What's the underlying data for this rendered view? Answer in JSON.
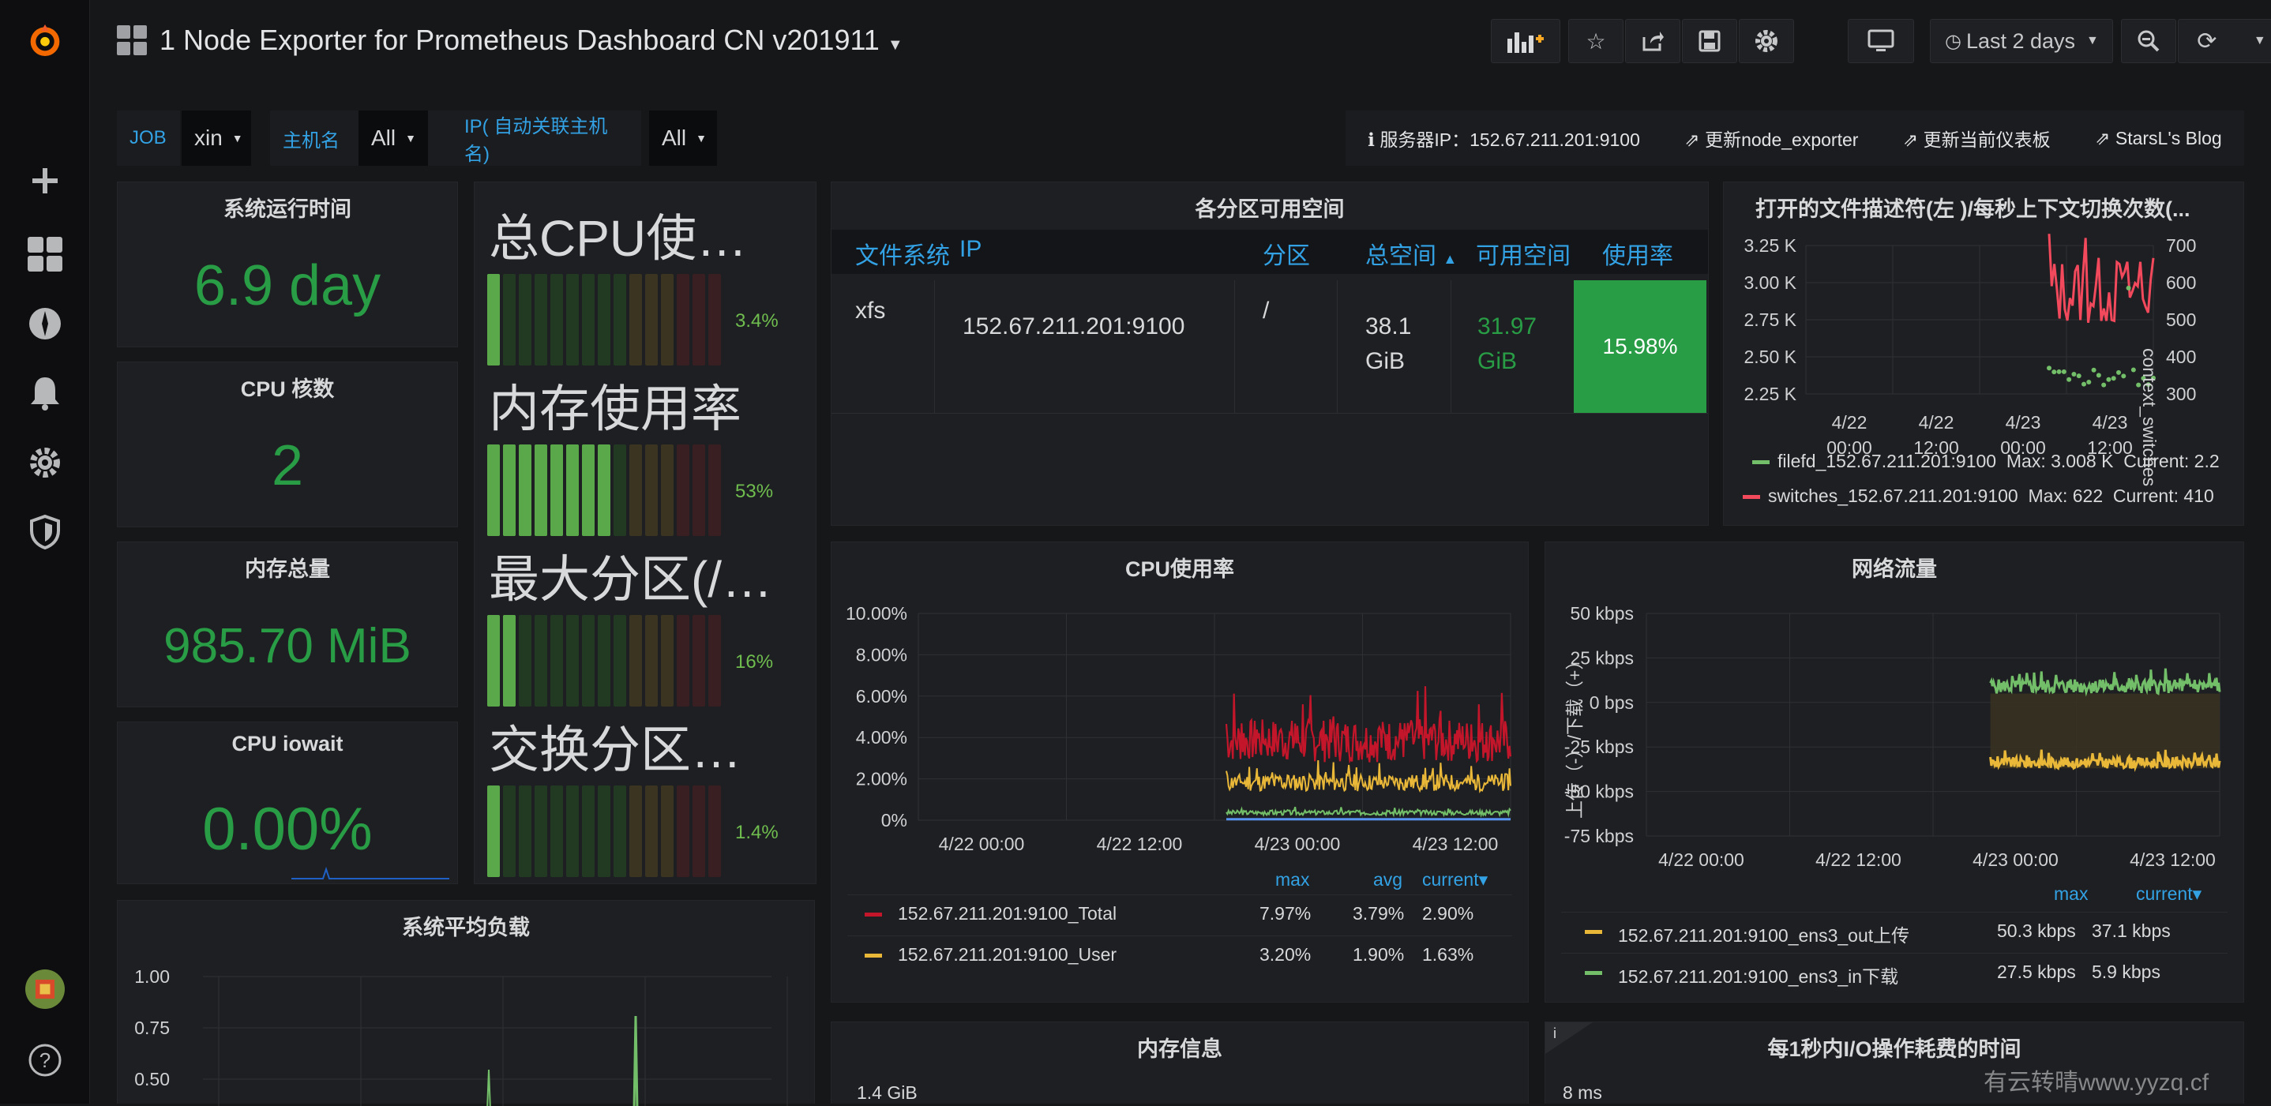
{
  "header": {
    "title": "1 Node Exporter for Prometheus Dashboard CN v201911",
    "time_range": "Last 2 days"
  },
  "variables": [
    {
      "label": "JOB",
      "value": "xin"
    },
    {
      "label": "主机名",
      "value": "All"
    },
    {
      "label": "IP( 自动关联主机名)",
      "value": "All"
    }
  ],
  "links": {
    "server": "服务器IP：152.67.211.201:9100",
    "update_exporter": "更新node_exporter",
    "update_dashboard": "更新当前仪表板",
    "blog": "StarsL's Blog"
  },
  "stats": {
    "uptime": {
      "title": "系统运行时间",
      "value": "6.9 day"
    },
    "cpu_cores": {
      "title": "CPU 核数",
      "value": "2"
    },
    "mem_total": {
      "title": "内存总量",
      "value": "985.70 MiB"
    },
    "iowait": {
      "title": "CPU iowait",
      "value": "0.00%"
    }
  },
  "gauges": [
    {
      "title": "总CPU使用率",
      "value_label": "3.4%",
      "value": 3.4
    },
    {
      "title": "内存使用率",
      "value_label": "53%",
      "value": 53
    },
    {
      "title": "最大分区(/)使用率",
      "value_label": "16%",
      "value": 16
    },
    {
      "title": "交换分区使用率",
      "value_label": "1.4%",
      "value": 1.4
    }
  ],
  "partition_table": {
    "title": "各分区可用空间",
    "headers": [
      "文件系统",
      "IP",
      "分区",
      "总空间",
      "可用空间",
      "使用率"
    ],
    "sort_arrow": "▲",
    "row": {
      "fs": "xfs",
      "ip": "152.67.211.201:9100",
      "mount": "/",
      "total_1": "38.1",
      "total_2": "GiB",
      "avail_1": "31.97",
      "avail_2": "GiB",
      "usage": "15.98%"
    }
  },
  "fd_panel": {
    "title": "打开的文件描述符(左 )/每秒上下文切换次数(...",
    "right_axis_label": "context_switches",
    "legend": [
      {
        "name": "filefd_152.67.211.201:9100",
        "max": "Max: 3.008 K",
        "current": "Current: 2.2",
        "color": "#73bf69"
      },
      {
        "name": "switches_152.67.211.201:9100",
        "max": "Max: 622",
        "current": "Current: 410",
        "color": "#f2495c"
      }
    ]
  },
  "cpu_panel": {
    "title": "CPU使用率",
    "legend_headers": [
      "max",
      "avg",
      "current▾"
    ],
    "legend": [
      {
        "name": "152.67.211.201:9100_Total",
        "max": "7.97%",
        "avg": "3.79%",
        "current": "2.90%",
        "color": "#c4162a"
      },
      {
        "name": "152.67.211.201:9100_User",
        "max": "3.20%",
        "avg": "1.90%",
        "current": "1.63%",
        "color": "#eab839"
      }
    ]
  },
  "net_panel": {
    "title": "网络流量",
    "y_label": "上传（-）/下载（+）",
    "legend_headers": [
      "max",
      "current▾"
    ],
    "legend": [
      {
        "name": "152.67.211.201:9100_ens3_out上传",
        "max": "50.3 kbps",
        "current": "37.1 kbps",
        "color": "#eab839"
      },
      {
        "name": "152.67.211.201:9100_ens3_in下载",
        "max": "27.5 kbps",
        "current": "5.9 kbps",
        "color": "#73bf69"
      }
    ]
  },
  "load_panel": {
    "title": "系统平均负载"
  },
  "mem_panel": {
    "title": "内存信息",
    "first_tick": "1.4 GiB"
  },
  "io_panel": {
    "title": "每1秒内I/O操作耗费的时间",
    "first_tick": "8 ms",
    "info": "i"
  },
  "watermark": "有云转晴www.yyzq.cf",
  "chart_data": [
    {
      "type": "line",
      "title": "CPU使用率",
      "x": [
        "4/22 00:00",
        "4/22 12:00",
        "4/23 00:00",
        "4/23 12:00"
      ],
      "ylim": [
        0,
        10
      ],
      "y_ticks": [
        "10.00%",
        "8.00%",
        "6.00%",
        "4.00%",
        "2.00%",
        "0%"
      ],
      "series": [
        {
          "name": "152.67.211.201:9100_Total",
          "max": 7.97,
          "avg": 3.79,
          "current": 2.9
        },
        {
          "name": "152.67.211.201:9100_User",
          "max": 3.2,
          "avg": 1.9,
          "current": 1.63
        }
      ]
    },
    {
      "type": "line",
      "title": "网络流量",
      "x": [
        "4/22 00:00",
        "4/22 12:00",
        "4/23 00:00",
        "4/23 12:00"
      ],
      "ylim": [
        -75,
        50
      ],
      "y_ticks": [
        "50 kbps",
        "25 kbps",
        "0 bps",
        "-25 kbps",
        "-50 kbps",
        "-75 kbps"
      ],
      "series": [
        {
          "name": "152.67.211.201:9100_ens3_out上传",
          "max": 50.3,
          "current": 37.1
        },
        {
          "name": "152.67.211.201:9100_ens3_in下载",
          "max": 27.5,
          "current": 5.9
        }
      ]
    },
    {
      "type": "line",
      "title": "打开的文件描述符(左 )/每秒上下文切换次数(...",
      "x": [
        "4/22 00:00",
        "4/22 12:00",
        "4/23 00:00",
        "4/23 12:00"
      ],
      "y_ticks_left": [
        "3.25 K",
        "3.00 K",
        "2.75 K",
        "2.50 K",
        "2.25 K"
      ],
      "y_ticks_right": [
        "700",
        "600",
        "500",
        "400",
        "300"
      ],
      "series": [
        {
          "name": "filefd_152.67.211.201:9100",
          "max": 3008
        },
        {
          "name": "switches_152.67.211.201:9100",
          "max": 622,
          "current": 410
        }
      ]
    },
    {
      "type": "line",
      "title": "系统平均负载",
      "y_ticks": [
        "1.00",
        "0.75",
        "0.50"
      ]
    }
  ]
}
